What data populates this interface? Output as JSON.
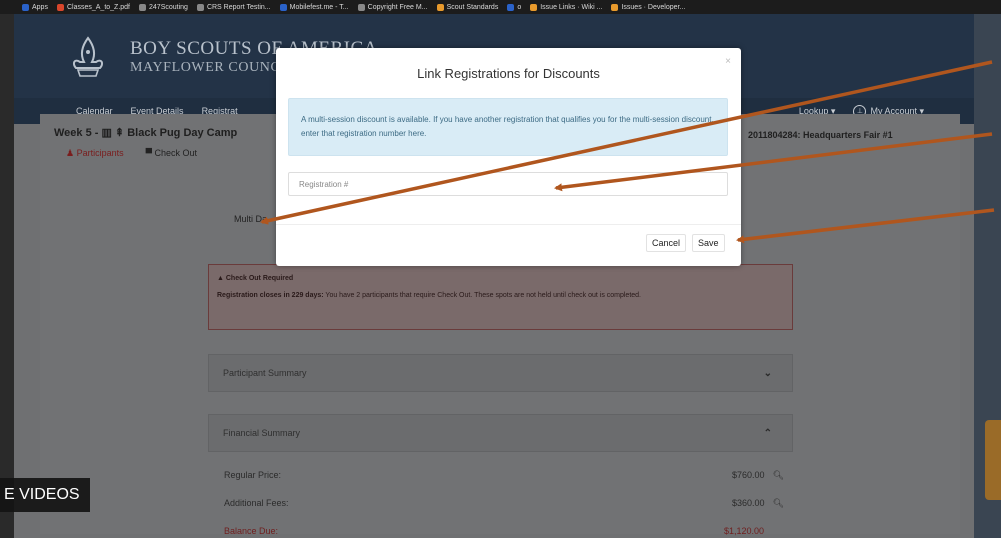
{
  "bookmarks": [
    {
      "label": "Apps",
      "icon": "apps-grid-icon"
    },
    {
      "label": "Classes_A_to_Z.pdf",
      "icon": "pdf-icon"
    },
    {
      "label": "247Scouting",
      "icon": "bookmark-icon"
    },
    {
      "label": "CRS Report Testin...",
      "icon": "github-icon"
    },
    {
      "label": "Mobilefest.me - T...",
      "icon": "bookmark-icon"
    },
    {
      "label": "Copyright Free M...",
      "icon": "github-icon"
    },
    {
      "label": "Scout Standards",
      "icon": "pencil-icon"
    },
    {
      "label": "o",
      "icon": "bookmark-icon"
    },
    {
      "label": "Issue Links · Wiki ...",
      "icon": "gitlab-icon"
    },
    {
      "label": "Issues · Developer...",
      "icon": "gitlab-icon"
    }
  ],
  "site": {
    "org_name": "BOY SCOUTS OF AMERICA",
    "council_name": "MAYFLOWER COUNCIL",
    "nav": [
      "Calendar",
      "Event Details",
      "Registrat"
    ],
    "nav_right": {
      "lookup": "Lookup ▾",
      "account": "My Account ▾"
    },
    "event_title": "Week 5 - ▥ ⇞ Black Pug Day Camp",
    "reg_ref": "2011804284: Headquarters Fair #1",
    "tabs": {
      "participants": "Participants",
      "checkout": "Check Out"
    },
    "multi_label": "Multi Da",
    "alert": {
      "title": "Check Out Required",
      "deadline": "Registration closes in 229 days:",
      "body": " You have 2 participants that require Check Out. These spots are not held until check out is completed."
    },
    "participant_summary": "Participant Summary",
    "financial_summary": "Financial Summary",
    "regular_price_label": "Regular Price:",
    "regular_price": "$760.00",
    "additional_fees_label": "Additional Fees:",
    "additional_fees": "$360.00",
    "balance_due_label": "Balance Due:",
    "balance_due": "$1,120.00"
  },
  "modal": {
    "title": "Link Registrations for Discounts",
    "close": "×",
    "info": "A multi-session discount is available. If you have another registration that qualifies you for the multi-session discount, enter that registration number here.",
    "input_placeholder": "Registration #",
    "cancel": "Cancel",
    "save": "Save"
  },
  "overlay_caption": "E VIDEOS",
  "colors": {
    "arrow": "#b0561e",
    "header": "#233347",
    "info_bg": "#d9ecf6"
  }
}
